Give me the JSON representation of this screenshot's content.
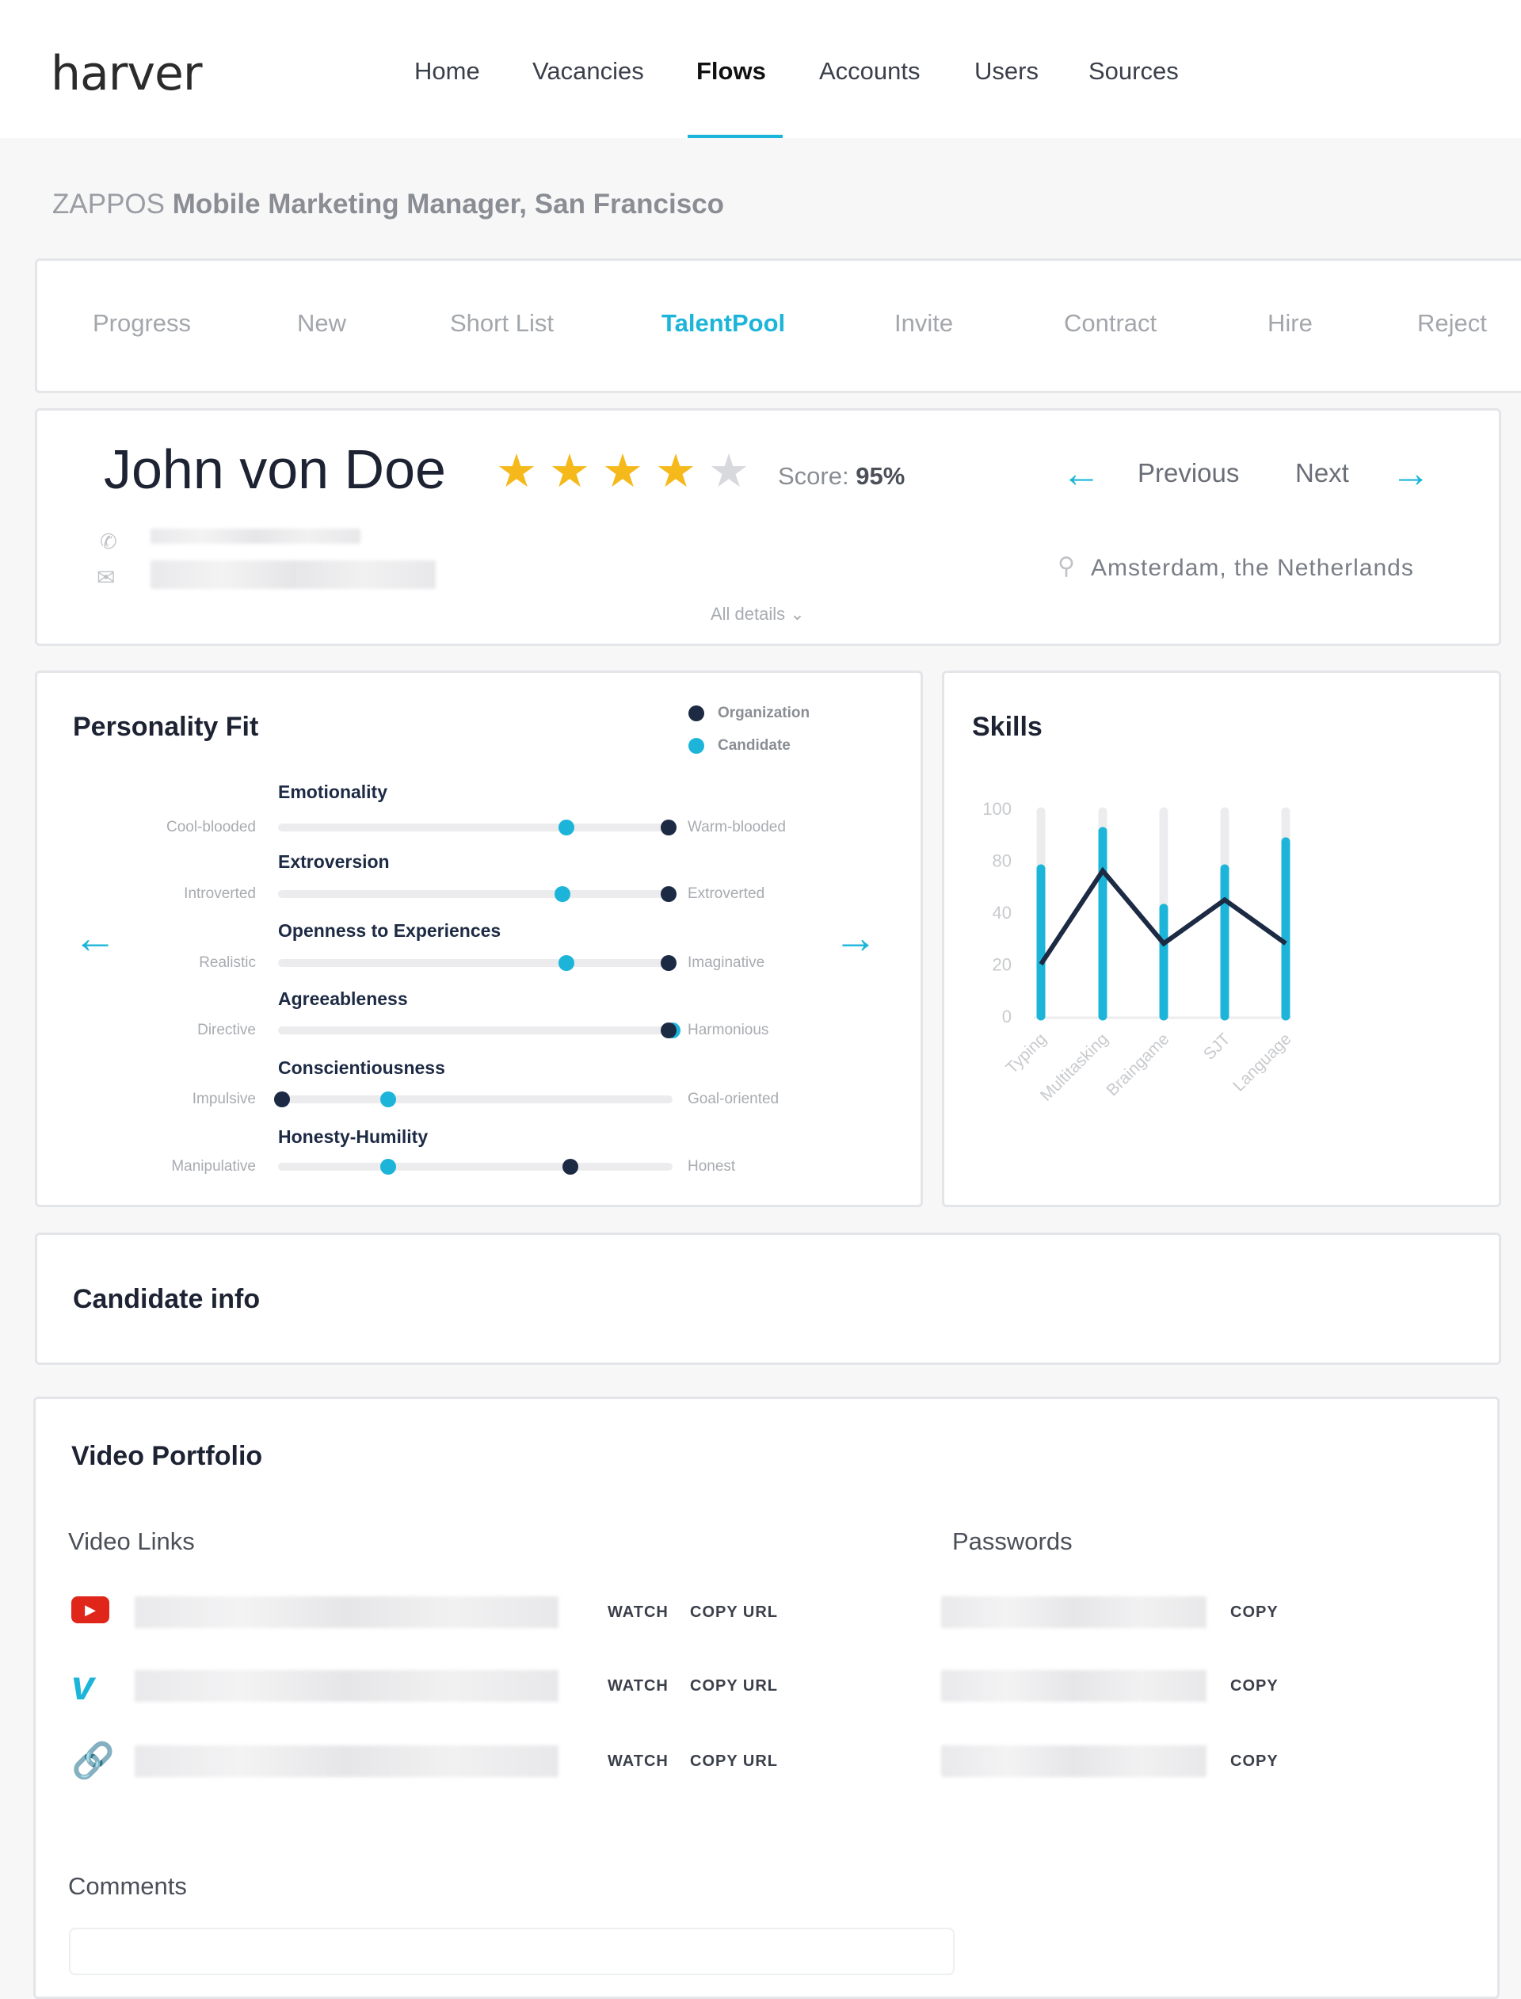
{
  "header": {
    "logo": "harver",
    "nav": [
      {
        "label": "Home"
      },
      {
        "label": "Vacancies"
      },
      {
        "label": "Flows",
        "active": true
      },
      {
        "label": "Accounts"
      },
      {
        "label": "Users"
      },
      {
        "label": "Sources"
      }
    ]
  },
  "page": {
    "company": "ZAPPOS",
    "job": "Mobile Marketing Manager, San Francisco"
  },
  "tabs": [
    {
      "label": "Progress"
    },
    {
      "label": "New"
    },
    {
      "label": "Short List"
    },
    {
      "label": "TalentPool",
      "active": true
    },
    {
      "label": "Invite"
    },
    {
      "label": "Contract"
    },
    {
      "label": "Hire"
    },
    {
      "label": "Reject"
    }
  ],
  "candidate": {
    "name": "John von Doe",
    "rating": 4,
    "rating_max": 5,
    "score_label": "Score:",
    "score": "95%",
    "previous": "Previous",
    "next": "Next",
    "location": "Amsterdam, the Netherlands",
    "all_details": "All details"
  },
  "personality": {
    "title": "Personality Fit",
    "legend": {
      "organization": "Organization",
      "candidate": "Candidate"
    },
    "colors": {
      "organization": "#1d2a44",
      "candidate": "#1cb5d9"
    },
    "traits": [
      {
        "name": "Emotionality",
        "left": "Cool-blooded",
        "right": "Warm-blooded",
        "candidate": 73,
        "organization": 99
      },
      {
        "name": "Extroversion",
        "left": "Introverted",
        "right": "Extroverted",
        "candidate": 72,
        "organization": 99
      },
      {
        "name": "Openness to Experiences",
        "left": "Realistic",
        "right": "Imaginative",
        "candidate": 73,
        "organization": 99
      },
      {
        "name": "Agreeableness",
        "left": "Directive",
        "right": "Harmonious",
        "candidate": 100,
        "organization": 99
      },
      {
        "name": "Conscientiousness",
        "left": "Impulsive",
        "right": "Goal-oriented",
        "candidate": 28,
        "organization": 1
      },
      {
        "name": "Honesty-Humility",
        "left": "Manipulative",
        "right": "Honest",
        "candidate": 28,
        "organization": 74
      }
    ]
  },
  "skills": {
    "title": "Skills"
  },
  "chart_data": {
    "type": "bar",
    "categories": [
      "Typing",
      "Multitasking",
      "Braingame",
      "SJT",
      "Language"
    ],
    "series": [
      {
        "type": "bar",
        "values": [
          71,
          89,
          52,
          71,
          84
        ],
        "color": "#1cb5d9"
      },
      {
        "type": "line",
        "values": [
          25,
          70,
          35,
          56,
          35
        ],
        "color": "#1d2a44"
      }
    ],
    "yticks": [
      "0",
      "20",
      "40",
      "80",
      "100"
    ],
    "ylim": [
      0,
      100
    ],
    "grid": false
  },
  "candidate_info": {
    "title": "Candidate info"
  },
  "video": {
    "title": "Video Portfolio",
    "links_label": "Video Links",
    "passwords_label": "Passwords",
    "rows": [
      {
        "icon": "youtube-icon",
        "watch": "WATCH",
        "copy_url": "COPY URL",
        "copy": "COPY"
      },
      {
        "icon": "vimeo-icon",
        "watch": "WATCH",
        "copy_url": "COPY URL",
        "copy": "COPY"
      },
      {
        "icon": "link-icon",
        "watch": "WATCH",
        "copy_url": "COPY URL",
        "copy": "COPY"
      }
    ],
    "comments_label": "Comments"
  }
}
